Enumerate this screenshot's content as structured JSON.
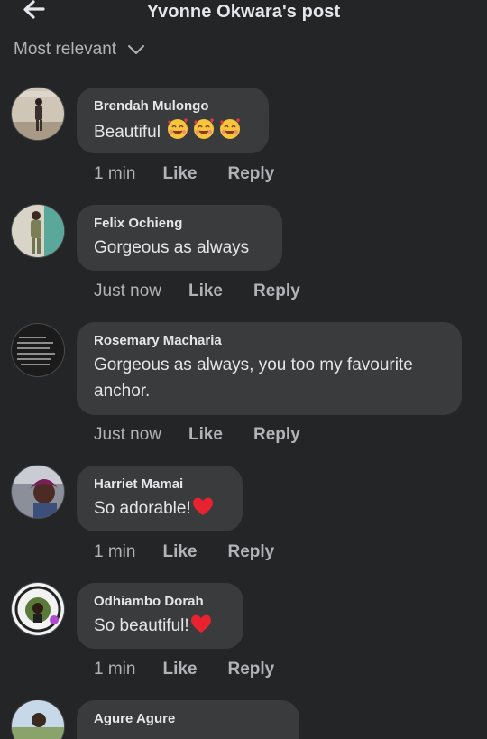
{
  "header": {
    "title": "Yvonne Okwara's post"
  },
  "sort": {
    "label": "Most relevant"
  },
  "actions": {
    "like": "Like",
    "reply": "Reply"
  },
  "comments": [
    {
      "author": "Brendah Mulongo",
      "text": "Beautiful",
      "time": "1 min"
    },
    {
      "author": "Felix Ochieng",
      "text": "Gorgeous as always",
      "time": "Just now"
    },
    {
      "author": "Rosemary Macharia",
      "text": "Gorgeous as always, you too my favourite",
      "text2": "anchor.",
      "time": "Just now"
    },
    {
      "author": "Harriet Mamai",
      "text": "So adorable!",
      "time": "1 min"
    },
    {
      "author": "Odhiambo Dorah",
      "text": "So beautiful!",
      "time": "1 min"
    },
    {
      "author": "Agure Agure"
    }
  ]
}
